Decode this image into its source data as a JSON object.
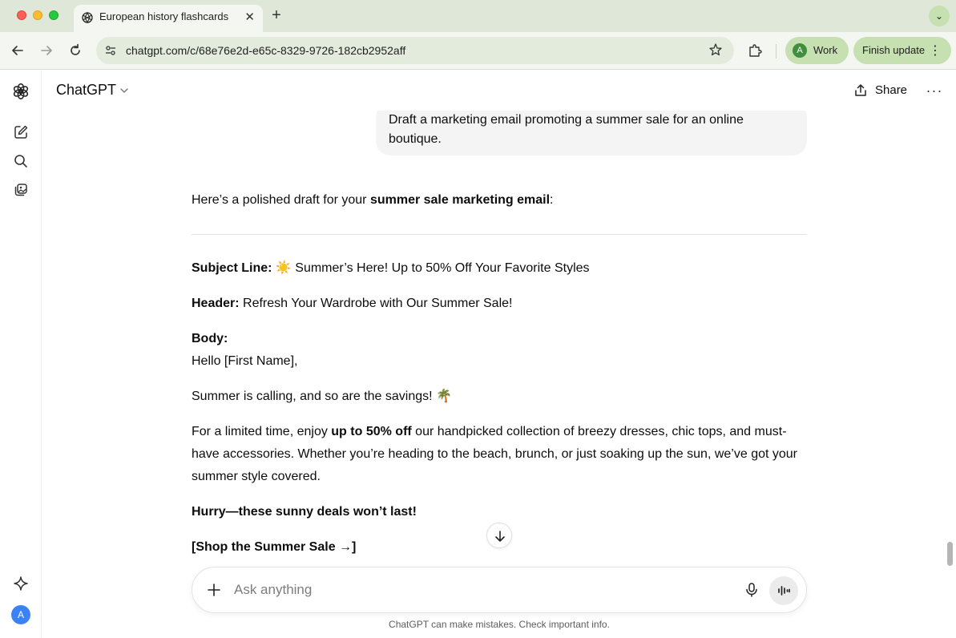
{
  "browser": {
    "tab_title": "European history flashcards",
    "url": "chatgpt.com/c/68e76e2d-e65c-8329-9726-182cb2952aff",
    "profile_initial": "A",
    "profile_label": "Work",
    "update_label": "Finish update"
  },
  "app": {
    "model_title": "ChatGPT",
    "share_label": "Share",
    "avatar_initial": "A"
  },
  "conversation": {
    "user_message": "Draft a marketing email promoting a summer sale for an online boutique.",
    "reply": {
      "intro_prefix": "Here’s a polished draft for your ",
      "intro_bold": "summer sale marketing email",
      "intro_suffix": ":",
      "subject_label": "Subject Line:",
      "subject_text": " ☀️ Summer’s Here! Up to 50% Off Your Favorite Styles",
      "header_label": "Header:",
      "header_text": " Refresh Your Wardrobe with Our Summer Sale!",
      "body_label": "Body:",
      "greeting": "Hello [First Name],",
      "line1": "Summer is calling, and so are the savings! 🌴",
      "para_prefix": "For a limited time, enjoy ",
      "para_bold": "up to 50% off",
      "para_suffix": " our handpicked collection of breezy dresses, chic tops, and must-have accessories. Whether you’re heading to the beach, brunch, or just soaking up the sun, we’ve got your summer style covered.",
      "hurry": "Hurry—these sunny deals won’t last!",
      "cta": "[Shop the Summer Sale →]"
    }
  },
  "composer": {
    "placeholder": "Ask anything",
    "disclaimer": "ChatGPT can make mistakes. Check important info."
  },
  "colors": {
    "tabbar": "#dfe8d8",
    "toolbar": "#f4f7f1",
    "pill_accent": "#c6e0b2",
    "user_bubble": "#f4f4f4",
    "avatar": "#3b82f6"
  }
}
